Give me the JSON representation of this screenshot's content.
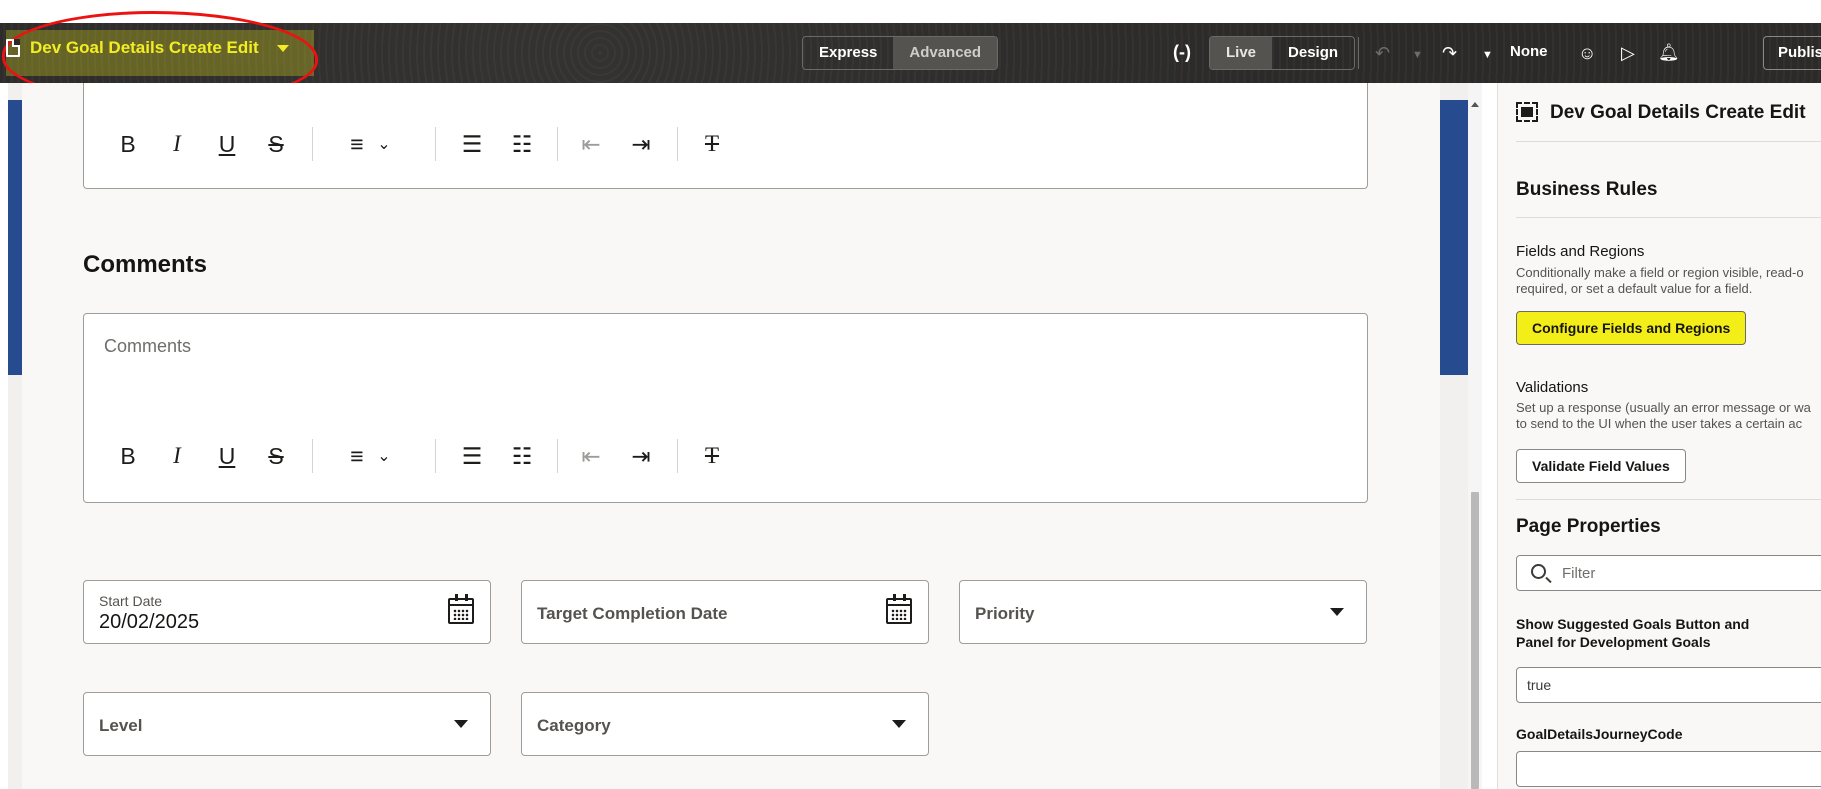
{
  "header": {
    "app_title": "Dev Goal Details Create Edit",
    "mode_express": "Express",
    "mode_advanced": "Advanced",
    "view_live": "Live",
    "view_design": "Design",
    "sandbox_label": "None",
    "publish_label": "Publis"
  },
  "editor": {
    "comments_heading": "Comments",
    "comments_placeholder": "Comments"
  },
  "fields": {
    "start_date_label": "Start Date",
    "start_date_value": "20/02/2025",
    "target_completion_label": "Target Completion Date",
    "priority_label": "Priority",
    "level_label": "Level",
    "category_label": "Category"
  },
  "panel": {
    "title": "Dev Goal Details Create Edit",
    "business_rules": "Business Rules",
    "fields_regions_heading": "Fields and Regions",
    "fields_regions_desc_1": "Conditionally make a field or region visible, read-o",
    "fields_regions_desc_2": "required, or set a default value for a field.",
    "configure_button": "Configure Fields and Regions",
    "validations_heading": "Validations",
    "validations_desc_1": "Set up a response (usually an error message or wa",
    "validations_desc_2": "to send to the UI when the user takes a certain ac",
    "validate_button": "Validate Field Values",
    "page_properties": "Page Properties",
    "filter_placeholder": "Filter",
    "suggested_goals_label_1": "Show Suggested Goals Button and",
    "suggested_goals_label_2": "Panel for Development Goals",
    "suggested_goals_value": "true",
    "journey_code_label": "GoalDetailsJourneyCode",
    "journey_code_value": ""
  },
  "colors": {
    "accent_yellow": "#f3ee24",
    "annotation_red": "#e11111",
    "band_blue": "#264b8f",
    "toolbar_dark": "#2b2a28"
  }
}
